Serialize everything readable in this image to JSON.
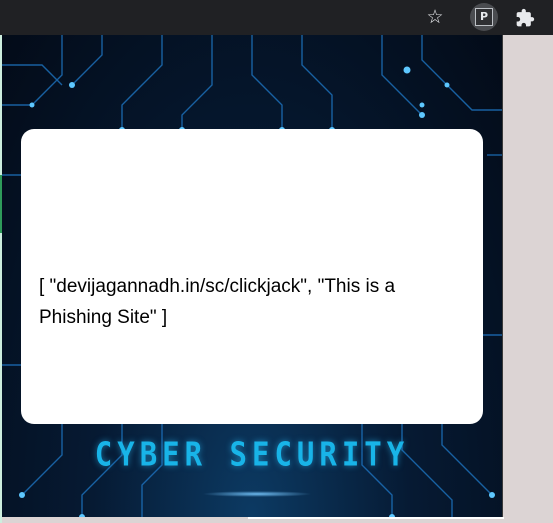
{
  "toolbar": {
    "bookmark_icon": "star-outline-icon",
    "extension_letter": "P",
    "extensions_icon": "puzzle-icon"
  },
  "popup": {
    "message": "[ \"devijagannadh.in/sc/clickjack\", \"This is a Phishing Site\" ]",
    "brand": "CYBER SECURITY",
    "colors": {
      "background": "#061a33",
      "brand": "#18b4e8",
      "card": "#ffffff"
    }
  }
}
